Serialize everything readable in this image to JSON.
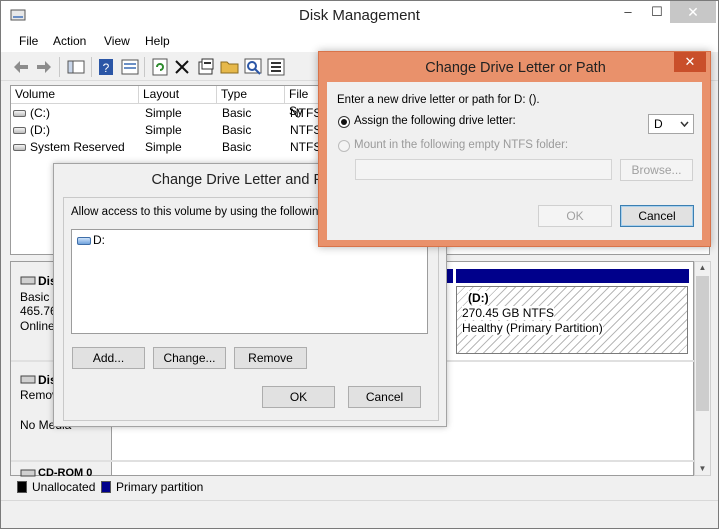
{
  "window": {
    "title": "Disk Management",
    "minimize": "–",
    "maximize": "☐",
    "close": "✕"
  },
  "menu": [
    "File",
    "Action",
    "View",
    "Help"
  ],
  "toolbar": {
    "icons": [
      "back-arrow-icon",
      "forward-arrow-icon",
      "console-tree-icon",
      "help-icon",
      "properties-icon",
      "refresh-icon",
      "delete-icon",
      "properties2-icon",
      "open-folder-icon",
      "search-icon",
      "settings-icon"
    ]
  },
  "volume_list": {
    "columns": [
      "Volume",
      "Layout",
      "Type",
      "File Sy"
    ],
    "rows": [
      {
        "volume": "(C:)",
        "layout": "Simple",
        "type": "Basic",
        "fs": "NTFS"
      },
      {
        "volume": "(D:)",
        "layout": "Simple",
        "type": "Basic",
        "fs": "NTFS"
      },
      {
        "volume": "System Reserved",
        "layout": "Simple",
        "type": "Basic",
        "fs": "NTFS"
      }
    ]
  },
  "disk_map": {
    "disk0": {
      "name": "Dis",
      "type": "Basic",
      "size": "465.76",
      "status": "Online"
    },
    "disk1": {
      "name": "Dis",
      "type": "Remov",
      "status": "No Media"
    },
    "cdrom": {
      "name": "CD-ROM 0"
    },
    "partition_d": {
      "name": "(D:)",
      "size": "270.45 GB NTFS",
      "status": "Healthy (Primary Partition)"
    }
  },
  "legend": {
    "unallocated": "Unallocated",
    "primary": "Primary partition",
    "unallocated_color": "#000000",
    "primary_color": "#00008b"
  },
  "dialog_paths": {
    "title": "Change Drive Letter and Paths",
    "instruction": "Allow access to this volume by using the following dri",
    "items": [
      "D:"
    ],
    "add_label": "Add...",
    "change_label": "Change...",
    "remove_label": "Remove",
    "ok_label": "OK",
    "cancel_label": "Cancel"
  },
  "dialog_letter": {
    "title": "Change Drive Letter or Path",
    "close": "✕",
    "prompt": "Enter a new drive letter or path for D: ().",
    "assign_label": "Assign the following drive letter:",
    "assign_selected": true,
    "drive_letter": "D",
    "mount_label": "Mount in the following empty NTFS folder:",
    "browse_label": "Browse...",
    "ok_label": "OK",
    "cancel_label": "Cancel",
    "title_bar_color": "#e9916b"
  }
}
